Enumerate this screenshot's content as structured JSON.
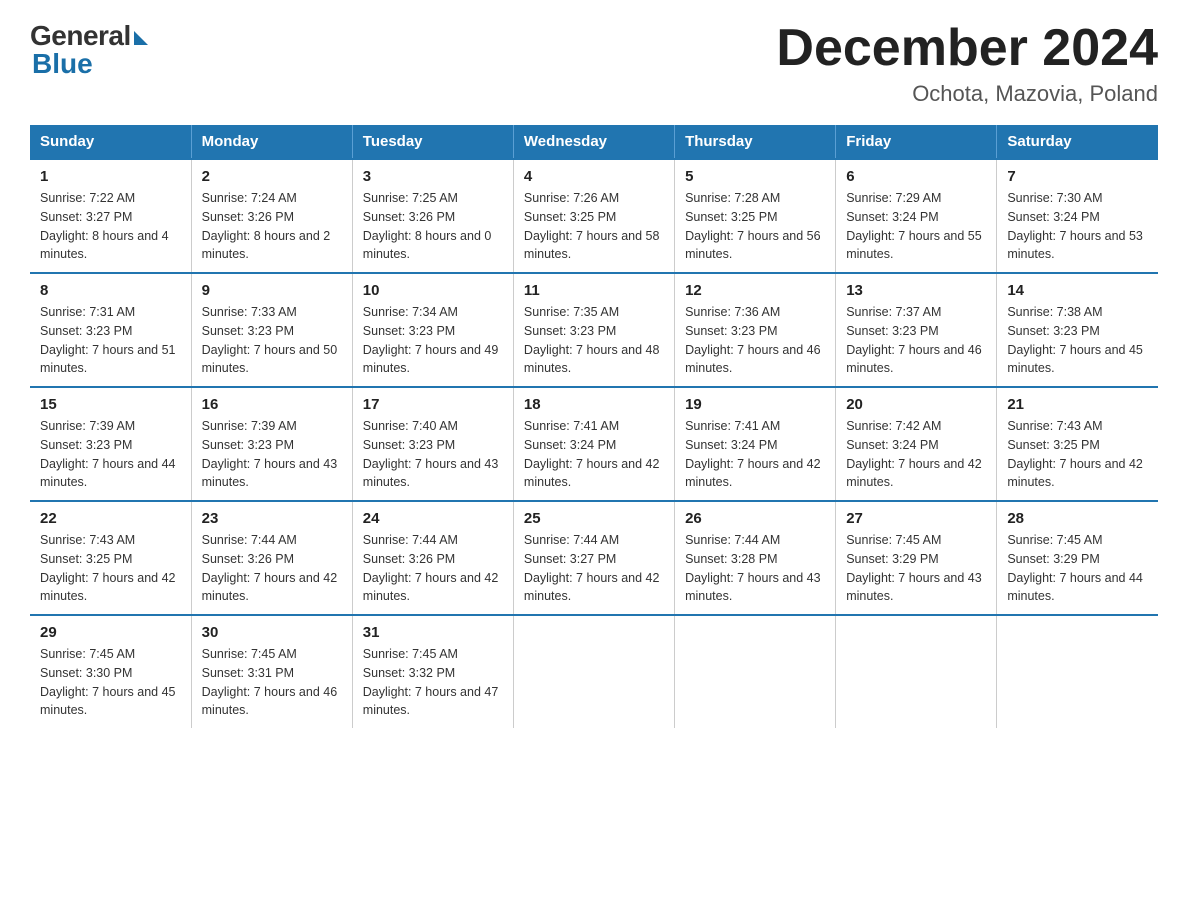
{
  "logo": {
    "general": "General",
    "blue": "Blue"
  },
  "title": "December 2024",
  "subtitle": "Ochota, Mazovia, Poland",
  "headers": [
    "Sunday",
    "Monday",
    "Tuesday",
    "Wednesday",
    "Thursday",
    "Friday",
    "Saturday"
  ],
  "weeks": [
    [
      {
        "day": "1",
        "sunrise": "7:22 AM",
        "sunset": "3:27 PM",
        "daylight": "8 hours and 4 minutes."
      },
      {
        "day": "2",
        "sunrise": "7:24 AM",
        "sunset": "3:26 PM",
        "daylight": "8 hours and 2 minutes."
      },
      {
        "day": "3",
        "sunrise": "7:25 AM",
        "sunset": "3:26 PM",
        "daylight": "8 hours and 0 minutes."
      },
      {
        "day": "4",
        "sunrise": "7:26 AM",
        "sunset": "3:25 PM",
        "daylight": "7 hours and 58 minutes."
      },
      {
        "day": "5",
        "sunrise": "7:28 AM",
        "sunset": "3:25 PM",
        "daylight": "7 hours and 56 minutes."
      },
      {
        "day": "6",
        "sunrise": "7:29 AM",
        "sunset": "3:24 PM",
        "daylight": "7 hours and 55 minutes."
      },
      {
        "day": "7",
        "sunrise": "7:30 AM",
        "sunset": "3:24 PM",
        "daylight": "7 hours and 53 minutes."
      }
    ],
    [
      {
        "day": "8",
        "sunrise": "7:31 AM",
        "sunset": "3:23 PM",
        "daylight": "7 hours and 51 minutes."
      },
      {
        "day": "9",
        "sunrise": "7:33 AM",
        "sunset": "3:23 PM",
        "daylight": "7 hours and 50 minutes."
      },
      {
        "day": "10",
        "sunrise": "7:34 AM",
        "sunset": "3:23 PM",
        "daylight": "7 hours and 49 minutes."
      },
      {
        "day": "11",
        "sunrise": "7:35 AM",
        "sunset": "3:23 PM",
        "daylight": "7 hours and 48 minutes."
      },
      {
        "day": "12",
        "sunrise": "7:36 AM",
        "sunset": "3:23 PM",
        "daylight": "7 hours and 46 minutes."
      },
      {
        "day": "13",
        "sunrise": "7:37 AM",
        "sunset": "3:23 PM",
        "daylight": "7 hours and 46 minutes."
      },
      {
        "day": "14",
        "sunrise": "7:38 AM",
        "sunset": "3:23 PM",
        "daylight": "7 hours and 45 minutes."
      }
    ],
    [
      {
        "day": "15",
        "sunrise": "7:39 AM",
        "sunset": "3:23 PM",
        "daylight": "7 hours and 44 minutes."
      },
      {
        "day": "16",
        "sunrise": "7:39 AM",
        "sunset": "3:23 PM",
        "daylight": "7 hours and 43 minutes."
      },
      {
        "day": "17",
        "sunrise": "7:40 AM",
        "sunset": "3:23 PM",
        "daylight": "7 hours and 43 minutes."
      },
      {
        "day": "18",
        "sunrise": "7:41 AM",
        "sunset": "3:24 PM",
        "daylight": "7 hours and 42 minutes."
      },
      {
        "day": "19",
        "sunrise": "7:41 AM",
        "sunset": "3:24 PM",
        "daylight": "7 hours and 42 minutes."
      },
      {
        "day": "20",
        "sunrise": "7:42 AM",
        "sunset": "3:24 PM",
        "daylight": "7 hours and 42 minutes."
      },
      {
        "day": "21",
        "sunrise": "7:43 AM",
        "sunset": "3:25 PM",
        "daylight": "7 hours and 42 minutes."
      }
    ],
    [
      {
        "day": "22",
        "sunrise": "7:43 AM",
        "sunset": "3:25 PM",
        "daylight": "7 hours and 42 minutes."
      },
      {
        "day": "23",
        "sunrise": "7:44 AM",
        "sunset": "3:26 PM",
        "daylight": "7 hours and 42 minutes."
      },
      {
        "day": "24",
        "sunrise": "7:44 AM",
        "sunset": "3:26 PM",
        "daylight": "7 hours and 42 minutes."
      },
      {
        "day": "25",
        "sunrise": "7:44 AM",
        "sunset": "3:27 PM",
        "daylight": "7 hours and 42 minutes."
      },
      {
        "day": "26",
        "sunrise": "7:44 AM",
        "sunset": "3:28 PM",
        "daylight": "7 hours and 43 minutes."
      },
      {
        "day": "27",
        "sunrise": "7:45 AM",
        "sunset": "3:29 PM",
        "daylight": "7 hours and 43 minutes."
      },
      {
        "day": "28",
        "sunrise": "7:45 AM",
        "sunset": "3:29 PM",
        "daylight": "7 hours and 44 minutes."
      }
    ],
    [
      {
        "day": "29",
        "sunrise": "7:45 AM",
        "sunset": "3:30 PM",
        "daylight": "7 hours and 45 minutes."
      },
      {
        "day": "30",
        "sunrise": "7:45 AM",
        "sunset": "3:31 PM",
        "daylight": "7 hours and 46 minutes."
      },
      {
        "day": "31",
        "sunrise": "7:45 AM",
        "sunset": "3:32 PM",
        "daylight": "7 hours and 47 minutes."
      },
      null,
      null,
      null,
      null
    ]
  ]
}
